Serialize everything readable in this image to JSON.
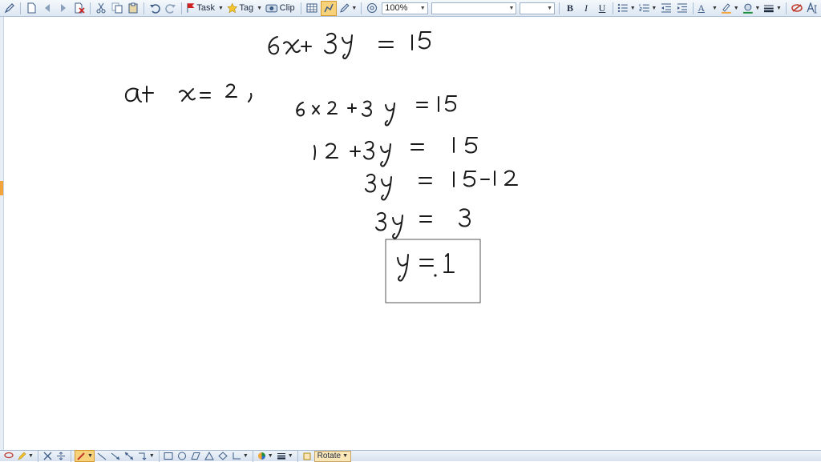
{
  "toolbar": {
    "task_label": "Task",
    "tag_label": "Tag",
    "clip_label": "Clip",
    "zoom_value": "100%",
    "font_name_value": "",
    "font_size_value": "",
    "bold_label": "B",
    "italic_label": "I",
    "underline_label": "U",
    "font_color_label": "A",
    "icons": [
      "pen-icon",
      "new-page-icon",
      "back-icon",
      "forward-icon",
      "delete-page-icon",
      "cut-icon",
      "copy-icon",
      "paste-icon",
      "undo-icon",
      "redo-icon",
      "task-flag-icon",
      "tag-star-icon",
      "clip-icon",
      "table-icon",
      "ink-mode-icon",
      "pen-settings-icon",
      "lasso-search-icon",
      "bullets-icon",
      "numbering-icon",
      "outdent-icon",
      "indent-icon",
      "font-color-icon",
      "highlight-icon",
      "fill-color-icon",
      "line-style-icon",
      "eraser-icon",
      "text-mode-icon"
    ],
    "colors": {
      "highlight": "#f2a33a",
      "fill": "#1a8f3a"
    }
  },
  "drawbar": {
    "rotate_label": "Rotate",
    "icons": [
      "lasso-icon",
      "pen-color-icon",
      "delete-icon",
      "insert-space-icon",
      "highlighter-icon",
      "line-icon",
      "arrow-icon",
      "double-arrow-icon",
      "connector-icon",
      "rectangle-icon",
      "circle-icon",
      "parallelogram-icon",
      "triangle-icon",
      "diamond-icon",
      "axes-icon",
      "color-wheel-icon",
      "line-weight-icon",
      "rotate-icon"
    ]
  },
  "handwriting": {
    "line1": "6x + 3y  =  15",
    "line2_label": "at  x = 2,",
    "line2": "6 × 2 + 3 y  = 15",
    "line3": "12 + 3y   =   15",
    "line4": "3y   =  15 - 12",
    "line5": "3y  =   3",
    "answer": "y = 1"
  },
  "colors": {
    "ink": "#1a1a1a",
    "accent": "#f2a33a",
    "toolbar_text": "#3a5a85"
  }
}
